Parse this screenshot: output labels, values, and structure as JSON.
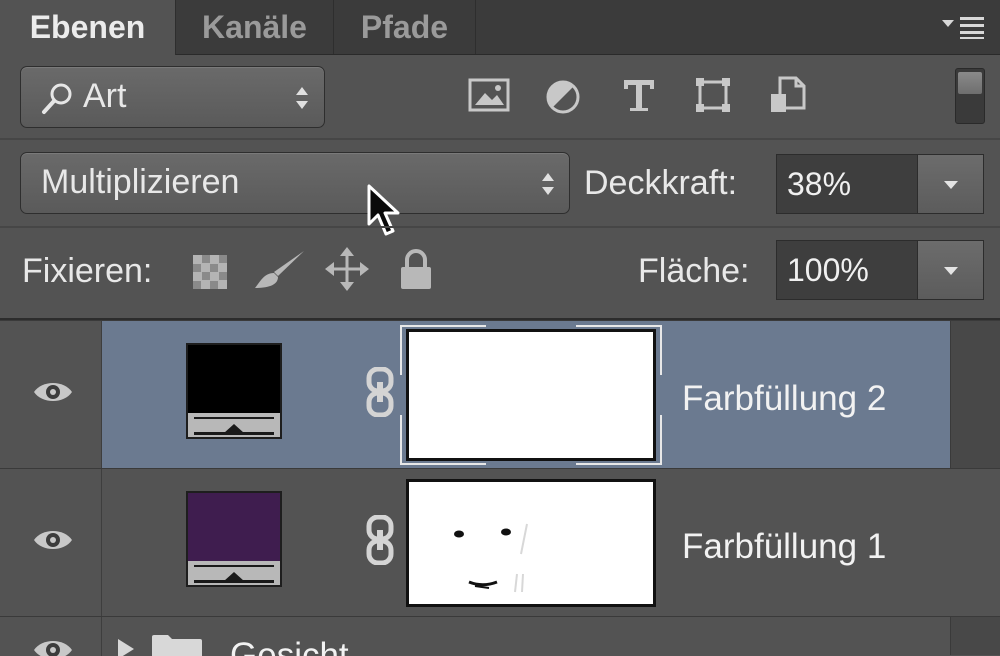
{
  "tabs": [
    {
      "label": "Ebenen",
      "active": true
    },
    {
      "label": "Kanäle",
      "active": false
    },
    {
      "label": "Pfade",
      "active": false
    }
  ],
  "filter": {
    "kind_label": "Art",
    "icons": [
      "image-filter-icon",
      "adjustment-filter-icon",
      "type-filter-icon",
      "shape-filter-icon",
      "smart-object-filter-icon"
    ]
  },
  "blend": {
    "mode": "Multipliziere­n",
    "opacity_label": "Deckkraft:",
    "opacity_value": "38%"
  },
  "lock": {
    "label": "Fixieren:",
    "fill_label": "Fläche:",
    "fill_value": "100%"
  },
  "layers": [
    {
      "name": "Farbfüllung 2",
      "fill_color": "#000000",
      "selected": true
    },
    {
      "name": "Farbfüllung 1",
      "fill_color": "#3f1d4f",
      "selected": false
    },
    {
      "name": "Gesicht",
      "type": "group"
    }
  ],
  "colors": {
    "selected_row": "#6b7a90",
    "panel_bg": "#535353"
  }
}
